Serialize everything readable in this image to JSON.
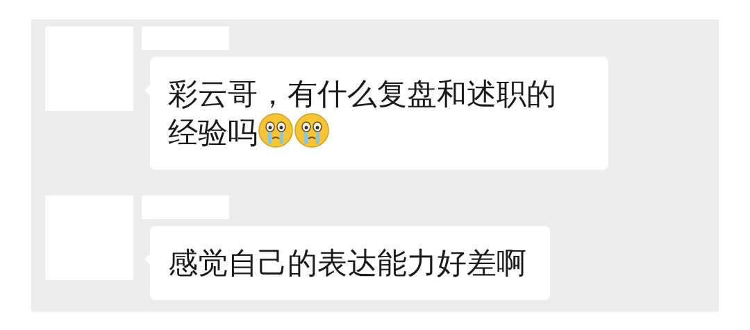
{
  "messages": [
    {
      "text": "彩云哥，有什么复盘和述职的经验吗",
      "emojis": [
        {
          "kind": "crying-face"
        },
        {
          "kind": "crying-face"
        }
      ]
    },
    {
      "text": "感觉自己的表达能力好差啊"
    }
  ]
}
